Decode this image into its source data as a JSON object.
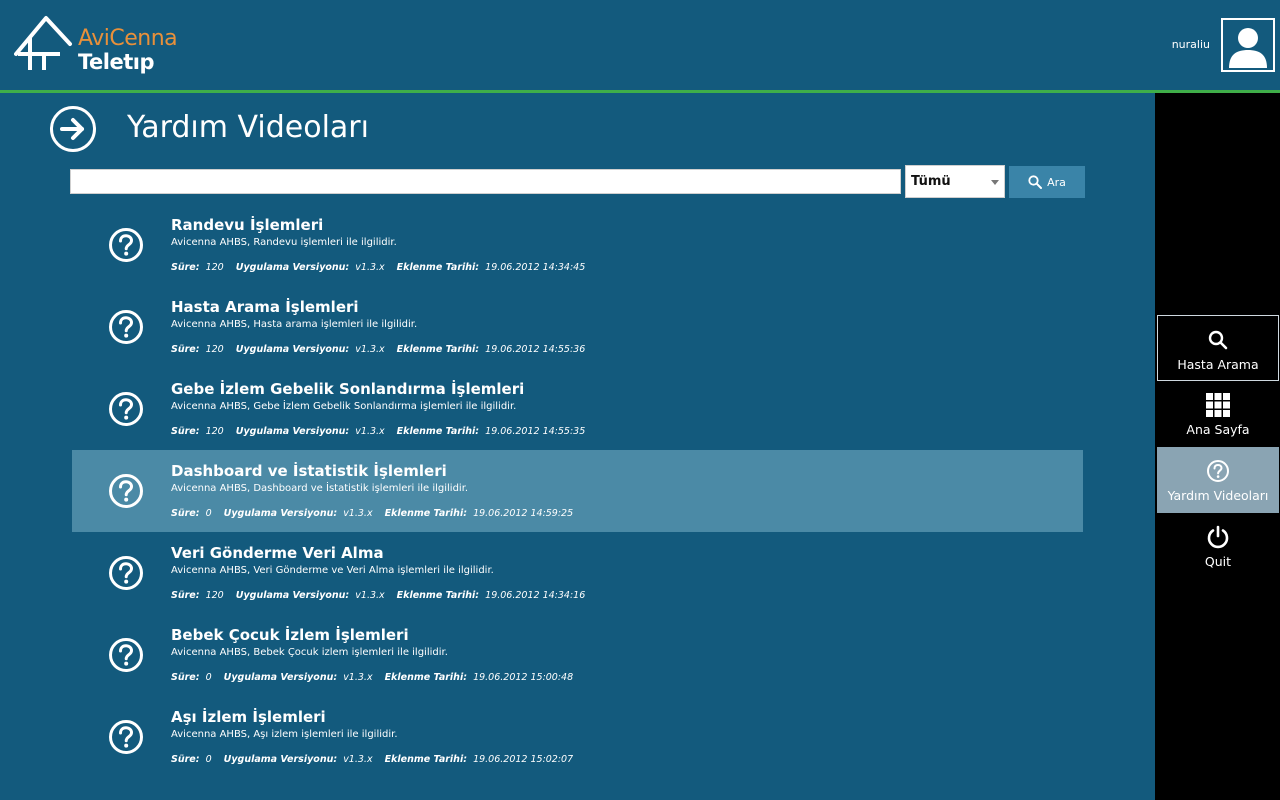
{
  "header": {
    "logo_line1": "AviCenna",
    "logo_line2": "Teletıp",
    "username": "nuraliu"
  },
  "page": {
    "title": "Yardım Videoları"
  },
  "search": {
    "placeholder": "",
    "value": "",
    "filter_selected": "Tümü",
    "button_label": "Ara"
  },
  "meta_labels": {
    "duration": "Süre:",
    "app_version": "Uygulama Versiyonu:",
    "added_date": "Eklenme Tarihi:"
  },
  "videos": [
    {
      "title": "Randevu İşlemleri",
      "description": "Avicenna AHBS, Randevu işlemleri ile ilgilidir.",
      "duration": "120",
      "version": "v1.3.x",
      "date": "19.06.2012 14:34:45",
      "selected": false
    },
    {
      "title": "Hasta Arama İşlemleri",
      "description": "Avicenna AHBS, Hasta arama işlemleri ile ilgilidir.",
      "duration": "120",
      "version": "v1.3.x",
      "date": "19.06.2012 14:55:36",
      "selected": false
    },
    {
      "title": "Gebe İzlem Gebelik Sonlandırma İşlemleri",
      "description": "Avicenna AHBS, Gebe İzlem Gebelik Sonlandırma işlemleri ile ilgilidir.",
      "duration": "120",
      "version": "v1.3.x",
      "date": "19.06.2012 14:55:35",
      "selected": false
    },
    {
      "title": "Dashboard ve İstatistik İşlemleri",
      "description": "Avicenna AHBS, Dashboard ve İstatistik işlemleri ile ilgilidir.",
      "duration": "0",
      "version": "v1.3.x",
      "date": "19.06.2012 14:59:25",
      "selected": true
    },
    {
      "title": "Veri Gönderme Veri Alma",
      "description": "Avicenna AHBS, Veri Gönderme ve Veri Alma işlemleri ile ilgilidir.",
      "duration": "120",
      "version": "v1.3.x",
      "date": "19.06.2012 14:34:16",
      "selected": false
    },
    {
      "title": "Bebek Çocuk İzlem İşlemleri",
      "description": "Avicenna AHBS, Bebek Çocuk izlem işlemleri ile ilgilidir.",
      "duration": "0",
      "version": "v1.3.x",
      "date": "19.06.2012 15:00:48",
      "selected": false
    },
    {
      "title": "Aşı İzlem İşlemleri",
      "description": "Avicenna AHBS, Aşı izlem işlemleri ile ilgilidir.",
      "duration": "0",
      "version": "v1.3.x",
      "date": "19.06.2012 15:02:07",
      "selected": false
    }
  ],
  "sidebar": {
    "items": [
      {
        "label": "Hasta Arama",
        "icon": "search-icon"
      },
      {
        "label": "Ana Sayfa",
        "icon": "grid-icon"
      },
      {
        "label": "Yardım Videoları",
        "icon": "help-icon",
        "active": true
      },
      {
        "label": "Quit",
        "icon": "power-icon"
      }
    ]
  },
  "colors": {
    "background": "#135a7d",
    "accent_line": "#3fae49",
    "logo_orange": "#e8903a",
    "selected_row": "#4b8aa6",
    "sidebar": "#000000",
    "sidebar_active": "#8aa4b3",
    "search_button": "#3a84a8"
  }
}
